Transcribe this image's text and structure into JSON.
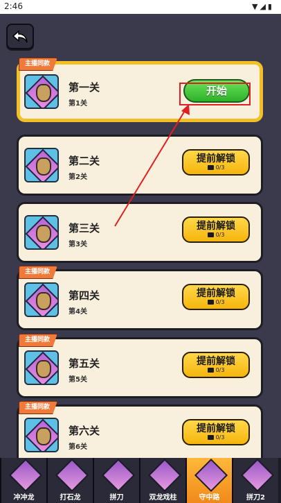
{
  "status": {
    "time": "2:46",
    "icons": "▼◢▮"
  },
  "levels": [
    {
      "tag": "主播同款",
      "title": "第一关",
      "sub": "第1关",
      "action": "start",
      "button": "开始"
    },
    {
      "tag": "",
      "title": "第二关",
      "sub": "第2关",
      "action": "unlock",
      "button": "提前解锁",
      "count": "0/3"
    },
    {
      "tag": "",
      "title": "第三关",
      "sub": "第3关",
      "action": "unlock",
      "button": "提前解锁",
      "count": "0/3"
    },
    {
      "tag": "主播同款",
      "title": "第四关",
      "sub": "第4关",
      "action": "unlock",
      "button": "提前解锁",
      "count": "0/3"
    },
    {
      "tag": "主播同款",
      "title": "第五关",
      "sub": "第5关",
      "action": "unlock",
      "button": "提前解锁",
      "count": "0/3"
    },
    {
      "tag": "主播同款",
      "title": "第六关",
      "sub": "第6关",
      "action": "unlock",
      "button": "提前解锁",
      "count": "0/3"
    }
  ],
  "tabs": [
    {
      "label": "冲冲龙",
      "active": false
    },
    {
      "label": "打石龙",
      "active": false
    },
    {
      "label": "拼刀",
      "active": false
    },
    {
      "label": "双龙戏柱",
      "active": false
    },
    {
      "label": "守中路",
      "active": true
    },
    {
      "label": "拼刀2",
      "active": false
    }
  ],
  "colors": {
    "accent_green": "#2fb12a",
    "accent_yellow": "#f5b50c",
    "annotation_red": "#e02020"
  }
}
